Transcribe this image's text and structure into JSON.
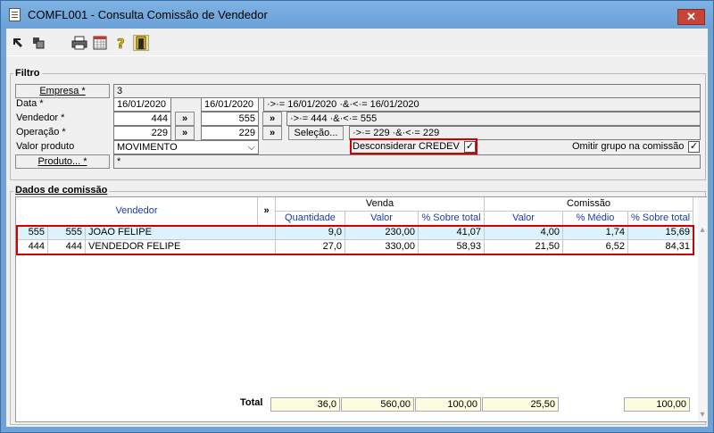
{
  "window": {
    "title": "COMFL001 - Consulta Comissão de Vendedor",
    "close_glyph": "✕"
  },
  "toolbar": {
    "icons": [
      "first-record-icon",
      "copy-record-icon",
      "print-icon",
      "calendar-grid-icon",
      "help-icon",
      "exit-door-icon"
    ]
  },
  "filtro": {
    "title": "Filtro",
    "empresa": {
      "label": "Empresa *",
      "value": "3"
    },
    "data": {
      "label": "Data *",
      "from": "16/01/2020",
      "to": "16/01/2020",
      "expr": "·>·= 16/01/2020 ·&·<·= 16/01/2020"
    },
    "vendedor": {
      "label": "Vendedor *",
      "from": "444",
      "to": "555",
      "expr": "·>·= 444 ·&·<·= 555"
    },
    "operacao": {
      "label": "Operação *",
      "from": "229",
      "to": "229",
      "expr": "·>·= 229 ·&·<·= 229",
      "selecao": "Seleção..."
    },
    "valor_produto": {
      "label": "Valor produto",
      "value": "MOVIMENTO"
    },
    "desconsiderar": {
      "label": "Desconsiderar CREDEV",
      "checked": "✓"
    },
    "omitir": {
      "label": "Omitir grupo na comissão",
      "checked": "✓"
    },
    "produto": {
      "label": "Produto... *",
      "value": "*"
    },
    "expand": "»"
  },
  "dados": {
    "title": "Dados de comissão",
    "headers": {
      "vendedor": "Vendedor",
      "expand": "»",
      "venda": "Venda",
      "comissao": "Comissão",
      "quantidade": "Quantidade",
      "valor": "Valor",
      "pct_total": "% Sobre total",
      "com_valor": "Valor",
      "pct_medio": "% Médio",
      "com_pct_total": "% Sobre total"
    },
    "rows": [
      {
        "cod1": "555",
        "cod2": "555",
        "nome": "JOAO FELIPE",
        "quantidade": "9,0",
        "valor": "230,00",
        "pct_total": "41,07",
        "com_valor": "4,00",
        "pct_medio": "1,74",
        "com_pct_total": "15,69"
      },
      {
        "cod1": "444",
        "cod2": "444",
        "nome": "VENDEDOR FELIPE",
        "quantidade": "27,0",
        "valor": "330,00",
        "pct_total": "58,93",
        "com_valor": "21,50",
        "pct_medio": "6,52",
        "com_pct_total": "84,31"
      }
    ],
    "total": {
      "label": "Total",
      "quantidade": "36,0",
      "valor": "560,00",
      "pct_total": "100,00",
      "com_valor": "25,50",
      "com_pct_total": "100,00"
    },
    "scroll_up": "▴",
    "scroll_down": "▾"
  }
}
